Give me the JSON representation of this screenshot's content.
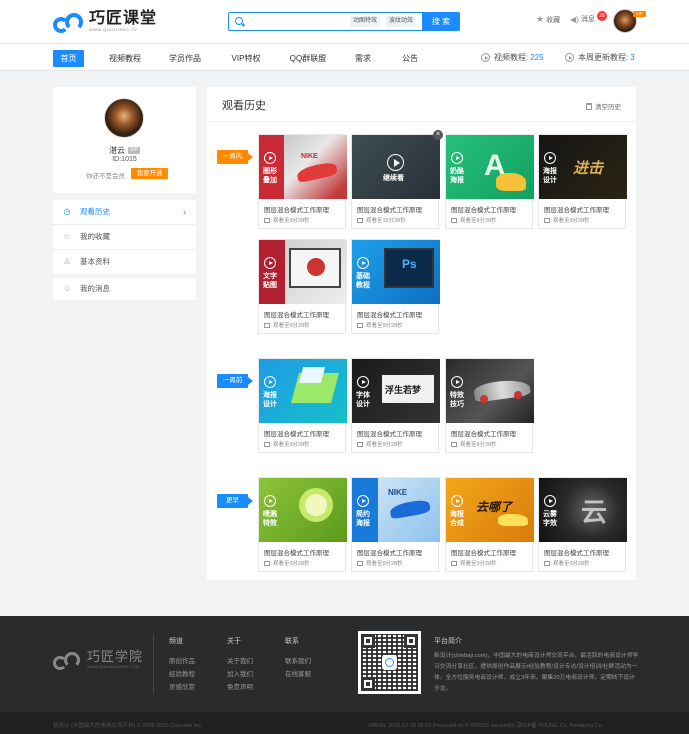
{
  "header": {
    "logo_title": "巧匠课堂",
    "logo_sub": "WWW.QIAOJIANG.TV",
    "search_placeholder": "",
    "search_tags": [
      "动图特效",
      "波纹动效"
    ],
    "search_button": "搜 索",
    "favorites": "收藏",
    "messages": "消息",
    "message_count": "28",
    "vip_badge": "VIP"
  },
  "nav": {
    "items": [
      "首页",
      "视频教程",
      "学员作品",
      "VIP特权",
      "QQ群联盟",
      "需求",
      "公告"
    ],
    "active_index": 0,
    "video_count_label": "视频教程:",
    "video_count": "225",
    "weekly_label": "本周更新教程:",
    "weekly_count": "3"
  },
  "profile": {
    "name": "湛云",
    "vip": "VIP",
    "id": "ID:1015",
    "note": "你还不是会员",
    "open_button": "我要开通"
  },
  "menu": {
    "items": [
      "观看历史",
      "我的收藏",
      "基本资料"
    ],
    "messages": "我的消息"
  },
  "history": {
    "title": "观看历史",
    "clear": "清空历史",
    "periods": [
      "一周内",
      "一周前",
      "更早"
    ],
    "cards": [
      {
        "title": "图层混合模式工作原理",
        "progress": "观看至9分28秒",
        "caption": "图形\n叠加"
      },
      {
        "title": "图层混合模式工作原理",
        "progress": "观看至16分28秒",
        "caption": "继续看"
      },
      {
        "title": "图层混合模式工作原理",
        "progress": "观看至9分28秒",
        "caption": "奶酪\n海报"
      },
      {
        "title": "图层混合模式工作原理",
        "progress": "观看至9分28秒",
        "caption": "海报\n设计"
      },
      {
        "title": "图层混合模式工作原理",
        "progress": "观看至9分28秒",
        "caption": "文字\n贴图"
      },
      {
        "title": "图层混合模式工作原理",
        "progress": "观看至9分28秒",
        "caption": "基础\n教程"
      },
      {
        "title": "图层混合模式工作原理",
        "progress": "观看至9分28秒",
        "caption": "海报\n设计"
      },
      {
        "title": "图层混合模式工作原理",
        "progress": "观看至9分28秒",
        "caption": "字体\n设计"
      },
      {
        "title": "图层混合模式工作原理",
        "progress": "观看至9分28秒",
        "caption": "特效\n技巧"
      },
      {
        "title": "图层混合模式工作原理",
        "progress": "观看至9分28秒",
        "caption": "喷溅\n特效"
      },
      {
        "title": "图层混合模式工作原理",
        "progress": "观看至9分28秒",
        "caption": "简约\n海报"
      },
      {
        "title": "图层混合模式工作原理",
        "progress": "观看至9分28秒",
        "caption": "海报\n合成"
      },
      {
        "title": "图层混合模式工作原理",
        "progress": "观看至9分28秒",
        "caption": "云雾\n字效"
      }
    ],
    "thumb_words": [
      "NIKE",
      "A",
      "进击",
      "Ps",
      "浮生若梦",
      "NIKE",
      "去哪了",
      "云"
    ]
  },
  "footer": {
    "logo_title": "巧匠学院",
    "logo_sub": "WWW.QIAOJIANGART.COM",
    "col1_title": "频道",
    "col1": [
      "原创作品",
      "经验教程",
      "灵感欣赏"
    ],
    "col2_title": "关于",
    "col2": [
      "关于我们",
      "加入我们",
      "免责声明"
    ],
    "col3_title": "联系",
    "col3": [
      "联系我们",
      "在线客服"
    ],
    "about_title": "平台简介",
    "about_text": "新设计(chinbaji.com)，中国最大的电商设计师交流平台，最活跃的电商设计师学习交流分享社区，提供原创作品展示/经验教程/设计专访/设计培训/社群活动为一体，全方位服务电商设计师，成立3年来，聚集20万电商设计师，定期线下设计沙龙。",
    "copyright_left": "新设计 (中国最大的电商交流平台) © 2009-2020 Cnocane Inc.",
    "copyright_right": "XMFHL 2020-12-18 05:02 Prosuced.cn © 000753 version(b) 京ICP备 YOUNG Co. Kentacha Co."
  },
  "colors": {
    "accent": "#1a8cff",
    "orange": "#ff8a00",
    "footer": "#2a2b2d"
  }
}
